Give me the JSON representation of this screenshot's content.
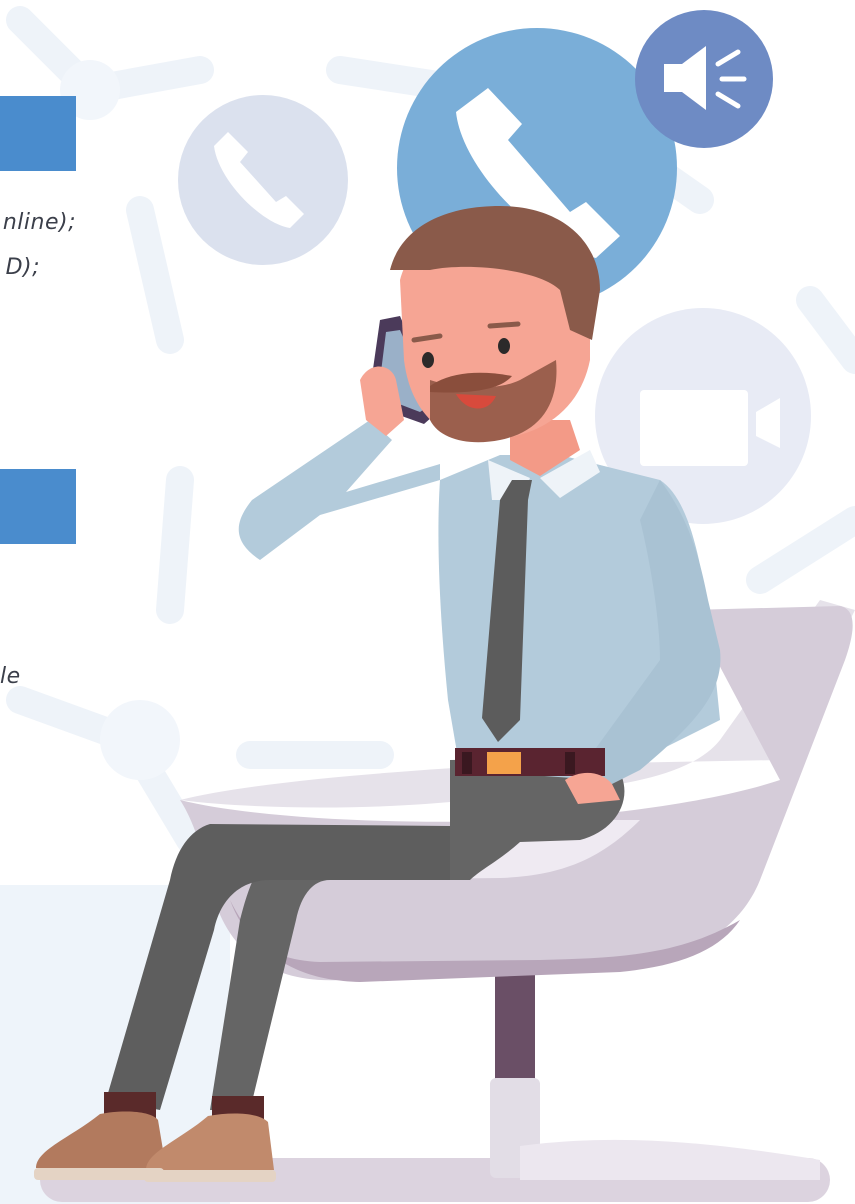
{
  "text_fragments": {
    "line_1": "nline);",
    "line_2": "D);",
    "line_3": "le"
  },
  "colors": {
    "accent_blue": "#4a8ccd",
    "phone_circle": "#7aaed8",
    "speaker_circle": "#6e8bc4",
    "shirt": "#b3cbdb",
    "pants": "#656565",
    "chair": "#d6d0dc",
    "hair": "#8a5a4a",
    "skin": "#f6a594"
  },
  "icons": {
    "phone_main": "phone-icon",
    "speaker": "speaker-icon",
    "phone_faded": "phone-icon",
    "video": "video-camera-icon"
  }
}
